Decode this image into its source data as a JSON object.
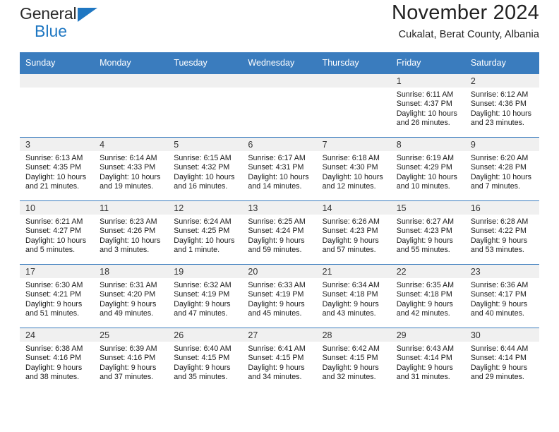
{
  "logo": {
    "word_top": "General",
    "word_bottom": "Blue",
    "triangle_icon": "triangle-icon",
    "accent_color": "#1f77c2"
  },
  "header": {
    "title": "November 2024",
    "subtitle": "Cukalat, Berat County, Albania"
  },
  "colors": {
    "header_blue": "#3a7cbe",
    "daynum_band": "#f0f0f0",
    "text": "#222222"
  },
  "weekdays": [
    "Sunday",
    "Monday",
    "Tuesday",
    "Wednesday",
    "Thursday",
    "Friday",
    "Saturday"
  ],
  "labels": {
    "sunrise_prefix": "Sunrise:",
    "sunset_prefix": "Sunset:",
    "daylight_prefix": "Daylight:"
  },
  "weeks": [
    [
      {
        "day": "",
        "sunrise": "",
        "sunset": "",
        "daylight_line1": "",
        "daylight_line2": ""
      },
      {
        "day": "",
        "sunrise": "",
        "sunset": "",
        "daylight_line1": "",
        "daylight_line2": ""
      },
      {
        "day": "",
        "sunrise": "",
        "sunset": "",
        "daylight_line1": "",
        "daylight_line2": ""
      },
      {
        "day": "",
        "sunrise": "",
        "sunset": "",
        "daylight_line1": "",
        "daylight_line2": ""
      },
      {
        "day": "",
        "sunrise": "",
        "sunset": "",
        "daylight_line1": "",
        "daylight_line2": ""
      },
      {
        "day": "1",
        "sunrise": "Sunrise: 6:11 AM",
        "sunset": "Sunset: 4:37 PM",
        "daylight_line1": "Daylight: 10 hours",
        "daylight_line2": "and 26 minutes."
      },
      {
        "day": "2",
        "sunrise": "Sunrise: 6:12 AM",
        "sunset": "Sunset: 4:36 PM",
        "daylight_line1": "Daylight: 10 hours",
        "daylight_line2": "and 23 minutes."
      }
    ],
    [
      {
        "day": "3",
        "sunrise": "Sunrise: 6:13 AM",
        "sunset": "Sunset: 4:35 PM",
        "daylight_line1": "Daylight: 10 hours",
        "daylight_line2": "and 21 minutes."
      },
      {
        "day": "4",
        "sunrise": "Sunrise: 6:14 AM",
        "sunset": "Sunset: 4:33 PM",
        "daylight_line1": "Daylight: 10 hours",
        "daylight_line2": "and 19 minutes."
      },
      {
        "day": "5",
        "sunrise": "Sunrise: 6:15 AM",
        "sunset": "Sunset: 4:32 PM",
        "daylight_line1": "Daylight: 10 hours",
        "daylight_line2": "and 16 minutes."
      },
      {
        "day": "6",
        "sunrise": "Sunrise: 6:17 AM",
        "sunset": "Sunset: 4:31 PM",
        "daylight_line1": "Daylight: 10 hours",
        "daylight_line2": "and 14 minutes."
      },
      {
        "day": "7",
        "sunrise": "Sunrise: 6:18 AM",
        "sunset": "Sunset: 4:30 PM",
        "daylight_line1": "Daylight: 10 hours",
        "daylight_line2": "and 12 minutes."
      },
      {
        "day": "8",
        "sunrise": "Sunrise: 6:19 AM",
        "sunset": "Sunset: 4:29 PM",
        "daylight_line1": "Daylight: 10 hours",
        "daylight_line2": "and 10 minutes."
      },
      {
        "day": "9",
        "sunrise": "Sunrise: 6:20 AM",
        "sunset": "Sunset: 4:28 PM",
        "daylight_line1": "Daylight: 10 hours",
        "daylight_line2": "and 7 minutes."
      }
    ],
    [
      {
        "day": "10",
        "sunrise": "Sunrise: 6:21 AM",
        "sunset": "Sunset: 4:27 PM",
        "daylight_line1": "Daylight: 10 hours",
        "daylight_line2": "and 5 minutes."
      },
      {
        "day": "11",
        "sunrise": "Sunrise: 6:23 AM",
        "sunset": "Sunset: 4:26 PM",
        "daylight_line1": "Daylight: 10 hours",
        "daylight_line2": "and 3 minutes."
      },
      {
        "day": "12",
        "sunrise": "Sunrise: 6:24 AM",
        "sunset": "Sunset: 4:25 PM",
        "daylight_line1": "Daylight: 10 hours",
        "daylight_line2": "and 1 minute."
      },
      {
        "day": "13",
        "sunrise": "Sunrise: 6:25 AM",
        "sunset": "Sunset: 4:24 PM",
        "daylight_line1": "Daylight: 9 hours",
        "daylight_line2": "and 59 minutes."
      },
      {
        "day": "14",
        "sunrise": "Sunrise: 6:26 AM",
        "sunset": "Sunset: 4:23 PM",
        "daylight_line1": "Daylight: 9 hours",
        "daylight_line2": "and 57 minutes."
      },
      {
        "day": "15",
        "sunrise": "Sunrise: 6:27 AM",
        "sunset": "Sunset: 4:23 PM",
        "daylight_line1": "Daylight: 9 hours",
        "daylight_line2": "and 55 minutes."
      },
      {
        "day": "16",
        "sunrise": "Sunrise: 6:28 AM",
        "sunset": "Sunset: 4:22 PM",
        "daylight_line1": "Daylight: 9 hours",
        "daylight_line2": "and 53 minutes."
      }
    ],
    [
      {
        "day": "17",
        "sunrise": "Sunrise: 6:30 AM",
        "sunset": "Sunset: 4:21 PM",
        "daylight_line1": "Daylight: 9 hours",
        "daylight_line2": "and 51 minutes."
      },
      {
        "day": "18",
        "sunrise": "Sunrise: 6:31 AM",
        "sunset": "Sunset: 4:20 PM",
        "daylight_line1": "Daylight: 9 hours",
        "daylight_line2": "and 49 minutes."
      },
      {
        "day": "19",
        "sunrise": "Sunrise: 6:32 AM",
        "sunset": "Sunset: 4:19 PM",
        "daylight_line1": "Daylight: 9 hours",
        "daylight_line2": "and 47 minutes."
      },
      {
        "day": "20",
        "sunrise": "Sunrise: 6:33 AM",
        "sunset": "Sunset: 4:19 PM",
        "daylight_line1": "Daylight: 9 hours",
        "daylight_line2": "and 45 minutes."
      },
      {
        "day": "21",
        "sunrise": "Sunrise: 6:34 AM",
        "sunset": "Sunset: 4:18 PM",
        "daylight_line1": "Daylight: 9 hours",
        "daylight_line2": "and 43 minutes."
      },
      {
        "day": "22",
        "sunrise": "Sunrise: 6:35 AM",
        "sunset": "Sunset: 4:18 PM",
        "daylight_line1": "Daylight: 9 hours",
        "daylight_line2": "and 42 minutes."
      },
      {
        "day": "23",
        "sunrise": "Sunrise: 6:36 AM",
        "sunset": "Sunset: 4:17 PM",
        "daylight_line1": "Daylight: 9 hours",
        "daylight_line2": "and 40 minutes."
      }
    ],
    [
      {
        "day": "24",
        "sunrise": "Sunrise: 6:38 AM",
        "sunset": "Sunset: 4:16 PM",
        "daylight_line1": "Daylight: 9 hours",
        "daylight_line2": "and 38 minutes."
      },
      {
        "day": "25",
        "sunrise": "Sunrise: 6:39 AM",
        "sunset": "Sunset: 4:16 PM",
        "daylight_line1": "Daylight: 9 hours",
        "daylight_line2": "and 37 minutes."
      },
      {
        "day": "26",
        "sunrise": "Sunrise: 6:40 AM",
        "sunset": "Sunset: 4:15 PM",
        "daylight_line1": "Daylight: 9 hours",
        "daylight_line2": "and 35 minutes."
      },
      {
        "day": "27",
        "sunrise": "Sunrise: 6:41 AM",
        "sunset": "Sunset: 4:15 PM",
        "daylight_line1": "Daylight: 9 hours",
        "daylight_line2": "and 34 minutes."
      },
      {
        "day": "28",
        "sunrise": "Sunrise: 6:42 AM",
        "sunset": "Sunset: 4:15 PM",
        "daylight_line1": "Daylight: 9 hours",
        "daylight_line2": "and 32 minutes."
      },
      {
        "day": "29",
        "sunrise": "Sunrise: 6:43 AM",
        "sunset": "Sunset: 4:14 PM",
        "daylight_line1": "Daylight: 9 hours",
        "daylight_line2": "and 31 minutes."
      },
      {
        "day": "30",
        "sunrise": "Sunrise: 6:44 AM",
        "sunset": "Sunset: 4:14 PM",
        "daylight_line1": "Daylight: 9 hours",
        "daylight_line2": "and 29 minutes."
      }
    ]
  ]
}
